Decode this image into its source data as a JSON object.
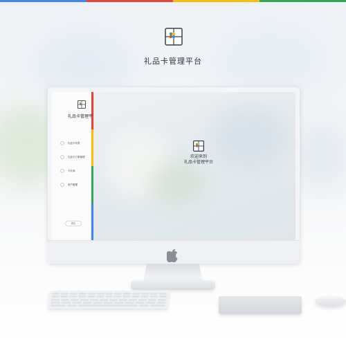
{
  "header": {
    "brand_icon": "gift-card-icon",
    "brand_title": "礼品卡管理平台"
  },
  "colors": {
    "strip": [
      "#4285f4",
      "#ea4335",
      "#fbbc05",
      "#34a853"
    ],
    "background": "#eef2f6",
    "accent_text": "#2f3440"
  },
  "monitor": {
    "sidebar": {
      "logo_icon": "gift-card-icon",
      "title": "礼品卡管理平台",
      "menu": [
        {
          "icon": "circle-icon",
          "label": "礼品卡列表"
        },
        {
          "icon": "circle-icon",
          "label": "礼品卡订单管理"
        },
        {
          "icon": "circle-icon",
          "label": "卡片库"
        },
        {
          "icon": "circle-icon",
          "label": "用户管理"
        }
      ],
      "logout_label": "退出"
    },
    "main": {
      "welcome_icon": "gift-card-icon",
      "welcome_line1": "欢迎来到",
      "welcome_line2": "礼品卡管理平台"
    },
    "chin_icon": "apple-icon"
  }
}
